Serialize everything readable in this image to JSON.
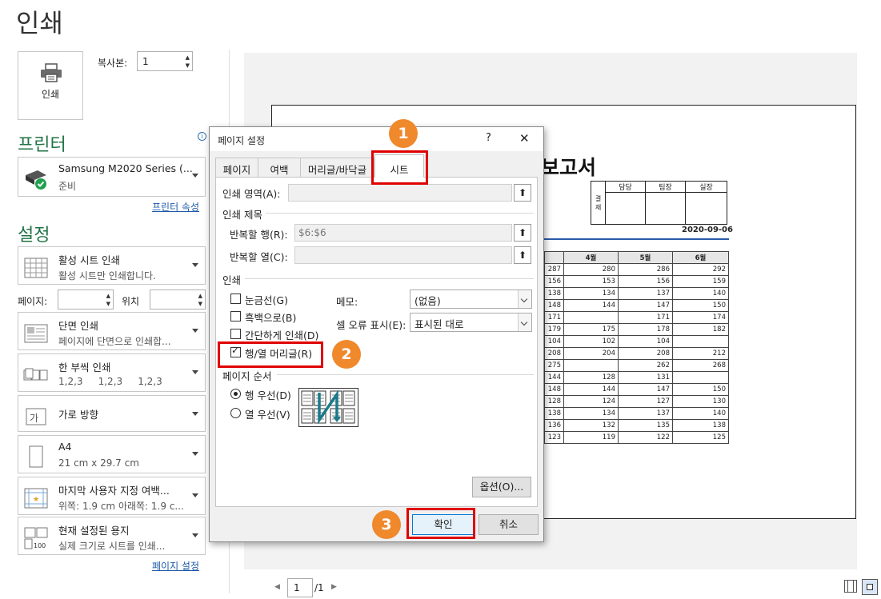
{
  "page_title": "인쇄",
  "print_button_label": "인쇄",
  "copies": {
    "label": "복사본:",
    "value": "1"
  },
  "printer": {
    "section_title": "프린터",
    "name": "Samsung M2020 Series (...",
    "status": "준비",
    "properties_link": "프린터 속성"
  },
  "settings": {
    "section_title": "설정",
    "options": [
      {
        "line1": "활성 시트 인쇄",
        "line2": "활성 시트만 인쇄합니다."
      },
      {
        "line1": "단면 인쇄",
        "line2": "페이지에 단면으로 인쇄합..."
      },
      {
        "line1": "한 부씩 인쇄",
        "line2": "1,2,3     1,2,3     1,2,3"
      },
      {
        "line1": "가로 방향",
        "line2": ""
      },
      {
        "line1": "A4",
        "line2": "21 cm x 29.7 cm"
      },
      {
        "line1": "마지막 사용자 지정 여백...",
        "line2": "위쪽: 1.9 cm 아래쪽: 1.9 c..."
      },
      {
        "line1": "현재 설정된 용지",
        "line2": "실제 크기로 시트를 인쇄..."
      }
    ],
    "pages_label": "페이지:",
    "to_label": "위치",
    "page_setup_link": "페이지 설정"
  },
  "pager": {
    "current": "1",
    "total": "/1"
  },
  "preview": {
    "report_title": "보고서",
    "approval": {
      "side": "결\n재",
      "cols": [
        "담당",
        "팀장",
        "실장"
      ]
    },
    "date": "2020-09-06",
    "headers": [
      "4월",
      "5월",
      "6월"
    ],
    "rows": [
      [
        "287",
        "280",
        "286",
        "292"
      ],
      [
        "156",
        "153",
        "156",
        "159"
      ],
      [
        "138",
        "134",
        "137",
        "140"
      ],
      [
        "148",
        "144",
        "147",
        "150"
      ],
      [
        "171",
        "",
        "171",
        "174"
      ],
      [
        "179",
        "175",
        "178",
        "182"
      ],
      [
        "104",
        "102",
        "104",
        ""
      ],
      [
        "208",
        "204",
        "208",
        "212"
      ],
      [
        "275",
        "",
        "262",
        "268"
      ],
      [
        "144",
        "128",
        "131",
        ""
      ],
      [
        "148",
        "144",
        "147",
        "150"
      ],
      [
        "128",
        "124",
        "127",
        "130"
      ],
      [
        "138",
        "134",
        "137",
        "140"
      ],
      [
        "136",
        "132",
        "135",
        "138"
      ],
      [
        "123",
        "119",
        "122",
        "125"
      ]
    ]
  },
  "dialog": {
    "title": "페이지 설정",
    "help": "?",
    "close": "✕",
    "tabs": [
      "페이지",
      "여백",
      "머리글/바닥글",
      "시트"
    ],
    "print_area_label": "인쇄 영역(A):",
    "print_titles_label": "인쇄 제목",
    "rows_repeat_label": "반복할 행(R):",
    "rows_repeat_value": "$6:$6",
    "cols_repeat_label": "반복할 열(C):",
    "print_group_label": "인쇄",
    "gridlines_label": "눈금선(G)",
    "bw_label": "흑백으로(B)",
    "draft_label": "간단하게 인쇄(D)",
    "headings_label": "행/열 머리글(R)",
    "comments_label": "메모:",
    "comments_value": "(없음)",
    "errors_label": "셀 오류 표시(E):",
    "errors_value": "표시된 대로",
    "page_order_label": "페이지 순서",
    "down_then_over": "행 우선(D)",
    "over_then_down": "열 우선(V)",
    "options_button": "옵션(O)...",
    "ok_button": "확인",
    "cancel_button": "취소"
  },
  "callouts": [
    "1",
    "2",
    "3"
  ],
  "colors": {
    "accent_green": "#217346",
    "callout_orange": "#f0882c",
    "highlight_red": "#e00000",
    "link_blue": "#1e5aa8"
  }
}
